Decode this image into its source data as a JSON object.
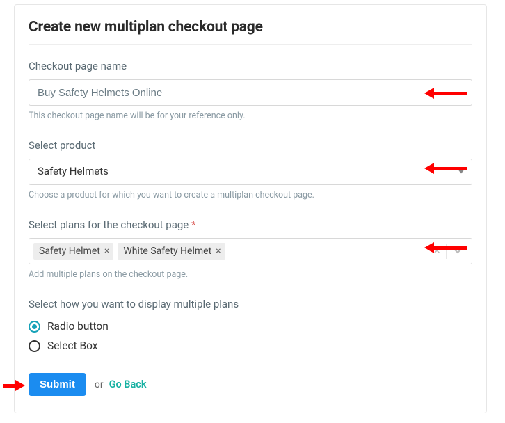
{
  "page": {
    "title": "Create new multiplan checkout page"
  },
  "checkoutName": {
    "label": "Checkout page name",
    "value": "Buy Safety Helmets Online",
    "help": "This checkout page name will be for your reference only."
  },
  "product": {
    "label": "Select product",
    "selected": "Safety Helmets",
    "help": "Choose a product for which you want to create a multiplan checkout page."
  },
  "plans": {
    "label": "Select plans for the checkout page",
    "required_mark": "*",
    "tags": [
      "Safety Helmet",
      "White Safety Helmet"
    ],
    "help": "Add multiple plans on the checkout page."
  },
  "display": {
    "label": "Select how you want to display multiple plans",
    "options": {
      "radio": "Radio button",
      "select": "Select Box"
    },
    "selected": "radio"
  },
  "actions": {
    "submit": "Submit",
    "or": "or",
    "go_back": "Go Back"
  }
}
